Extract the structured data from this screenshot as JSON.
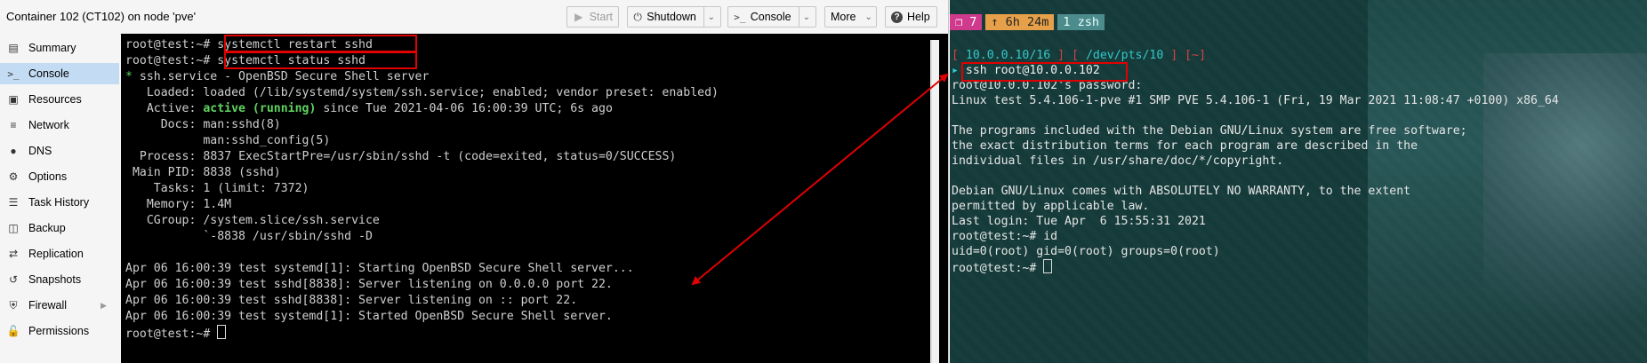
{
  "proxmox": {
    "window_title": "Container 102 (CT102) on node 'pve'",
    "toolbar": {
      "start_label": "Start",
      "shutdown_label": "Shutdown",
      "console_label": "Console",
      "more_label": "More",
      "help_label": "Help"
    },
    "sidebar": {
      "items": [
        {
          "label": "Summary",
          "icon": "book-icon"
        },
        {
          "label": "Console",
          "icon": "terminal-icon"
        },
        {
          "label": "Resources",
          "icon": "cube-icon"
        },
        {
          "label": "Network",
          "icon": "network-icon"
        },
        {
          "label": "DNS",
          "icon": "globe-icon"
        },
        {
          "label": "Options",
          "icon": "gear-icon"
        },
        {
          "label": "Task History",
          "icon": "list-icon"
        },
        {
          "label": "Backup",
          "icon": "floppy-icon"
        },
        {
          "label": "Replication",
          "icon": "retweet-icon"
        },
        {
          "label": "Snapshots",
          "icon": "history-icon"
        },
        {
          "label": "Firewall",
          "icon": "shield-icon"
        },
        {
          "label": "Permissions",
          "icon": "unlock-icon"
        }
      ],
      "active": "Console"
    },
    "console": {
      "prompt": "root@test:~#",
      "cmd1": "systemctl restart sshd",
      "cmd2": "systemctl status sshd",
      "bullet": "*",
      "service_title": "ssh.service - OpenBSD Secure Shell server",
      "loaded_label": "Loaded:",
      "loaded_value": "loaded (/lib/systemd/system/ssh.service; enabled; vendor preset: enabled)",
      "active_label": "Active:",
      "active_state": "active (running)",
      "active_since": "since Tue 2021-04-06 16:00:39 UTC; 6s ago",
      "docs_label": "Docs:",
      "docs_1": "man:sshd(8)",
      "docs_2": "man:sshd_config(5)",
      "process_label": "Process:",
      "process_value": "8837 ExecStartPre=/usr/sbin/sshd -t (code=exited, status=0/SUCCESS)",
      "pid_label": "Main PID:",
      "pid_value": "8838 (sshd)",
      "tasks_label": "Tasks:",
      "tasks_value": "1 (limit: 7372)",
      "memory_label": "Memory:",
      "memory_value": "1.4M",
      "cgroup_label": "CGroup:",
      "cgroup_value": "/system.slice/ssh.service",
      "cgroup_child": "`-8838 /usr/sbin/sshd -D",
      "log": [
        "Apr 06 16:00:39 test systemd[1]: Starting OpenBSD Secure Shell server...",
        "Apr 06 16:00:39 test sshd[8838]: Server listening on 0.0.0.0 port 22.",
        "Apr 06 16:00:39 test sshd[8838]: Server listening on :: port 22.",
        "Apr 06 16:00:39 test systemd[1]: Started OpenBSD Secure Shell server."
      ]
    }
  },
  "terminal": {
    "tmux": {
      "tab1": "❐ 7",
      "tab2": "↑ 6h 24m",
      "tab3": "1 zsh"
    },
    "status_ip": "10.0.0.10/16",
    "status_tty": "/dev/pts/10",
    "status_dir": "~",
    "ssh_cmd": "ssh root@10.0.0.102",
    "lines": [
      "root@10.0.0.102's password:",
      "Linux test 5.4.106-1-pve #1 SMP PVE 5.4.106-1 (Fri, 19 Mar 2021 11:08:47 +0100) x86_64",
      "",
      "The programs included with the Debian GNU/Linux system are free software;",
      "the exact distribution terms for each program are described in the",
      "individual files in /usr/share/doc/*/copyright.",
      "",
      "Debian GNU/Linux comes with ABSOLUTELY NO WARRANTY, to the extent",
      "permitted by applicable law.",
      "Last login: Tue Apr  6 15:55:31 2021",
      "root@test:~# id",
      "uid=0(root) gid=0(root) groups=0(root)"
    ],
    "prompt": "root@test:~#"
  },
  "colors": {
    "highlight": "#e00000",
    "active_nav": "#c3dcf4",
    "console_green": "#5fd35f",
    "terminal_cyan": "#33c8c8",
    "tmux_orange": "#e6a04a"
  }
}
